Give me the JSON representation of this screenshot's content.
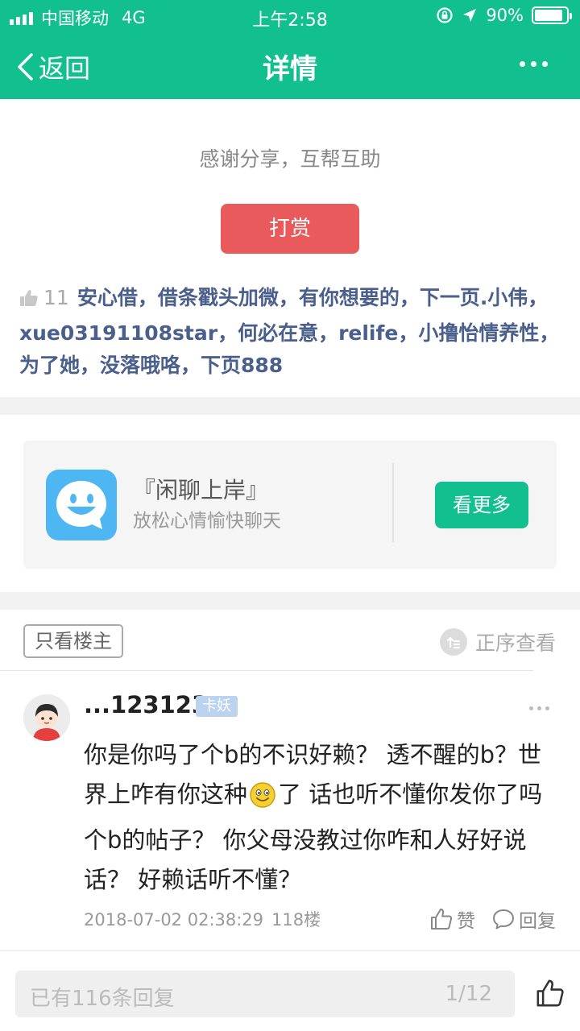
{
  "status_bar": {
    "carrier": "中国移动",
    "network": "4G",
    "time": "上午2:58",
    "battery_percent": "90%",
    "battery_level": 0.9
  },
  "nav": {
    "back_label": "返回",
    "title": "详情"
  },
  "reward": {
    "message": "感谢分享，互帮互助",
    "button_label": "打赏"
  },
  "likes": {
    "count": "11",
    "users": "安心借，借条戳头加微，有你想要的，下一页.小伟，xue03191108star，何必在意，relife，小撸怡情养性，为了她，没落哦咯，下页888"
  },
  "promo": {
    "title": "『闲聊上岸』",
    "subtitle": "放松心情愉快聊天",
    "button_label": "看更多"
  },
  "filter": {
    "only_owner_label": "只看楼主",
    "order_label": "正序查看"
  },
  "post": {
    "username": "...123123",
    "badge": "卡妖",
    "body_part1": "你是你吗了个b的不识好赖？ 透不醒的b？世界上咋有你这种",
    "body_part2": "了 话也听不懂你发你了吗个b的帖子？ 你父母没教过你咋和人好好说话？ 好赖话听不懂？",
    "timestamp": "2018-07-02 02:38:29",
    "floor": "118楼",
    "like_label": "赞",
    "reply_label": "回复"
  },
  "bottom": {
    "reply_placeholder": "已有116条回复",
    "page_indicator": "1/12"
  },
  "colors": {
    "brand_green": "#12c08f",
    "reward_red": "#e85a5c",
    "link_blue": "#4a5f8c"
  }
}
